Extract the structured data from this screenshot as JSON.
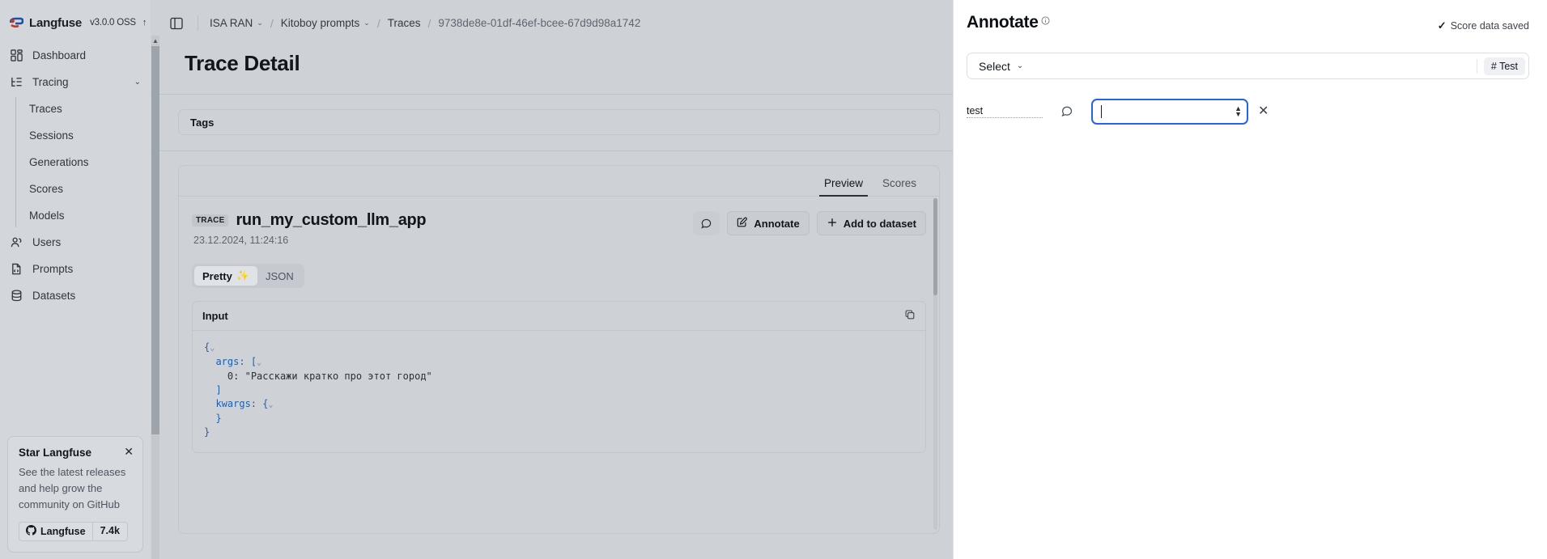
{
  "sidebar": {
    "brand": {
      "name": "Langfuse",
      "version": "v3.0.0 OSS",
      "arrow": "↑"
    },
    "items": [
      {
        "label": "Dashboard",
        "icon": "dashboard-icon"
      },
      {
        "label": "Tracing",
        "icon": "tracing-icon",
        "chevron": "⌄"
      },
      {
        "label": "Users",
        "icon": "users-icon"
      },
      {
        "label": "Prompts",
        "icon": "prompts-icon"
      },
      {
        "label": "Datasets",
        "icon": "datasets-icon"
      }
    ],
    "subitems": [
      {
        "label": "Traces"
      },
      {
        "label": "Sessions"
      },
      {
        "label": "Generations"
      },
      {
        "label": "Scores"
      },
      {
        "label": "Models"
      }
    ],
    "star_card": {
      "title": "Star Langfuse",
      "description": "See the latest releases and help grow the community on GitHub",
      "github_label": "Langfuse",
      "star_count": "7.4k",
      "close": "✕"
    }
  },
  "topbar": {
    "toggle_icon": "sidebar-toggle-icon",
    "breadcrumbs": [
      {
        "label": "ISA RAN",
        "chevron": "⌄"
      },
      {
        "label": "Kitoboy prompts",
        "chevron": "⌄"
      },
      {
        "label": "Traces",
        "chevron": ""
      },
      {
        "label": "9738de8e-01df-46ef-bcee-67d9d98a1742",
        "chevron": ""
      }
    ],
    "separator": "/"
  },
  "main": {
    "page_title": "Trace Detail",
    "tags_label": "Tags",
    "tabs": [
      {
        "label": "Preview",
        "active": true
      },
      {
        "label": "Scores",
        "active": false
      }
    ],
    "trace": {
      "badge": "TRACE",
      "name": "run_my_custom_llm_app",
      "timestamp": "23.12.2024, 11:24:16",
      "comment_icon": "comment-icon",
      "annotate_label": "Annotate",
      "annotate_icon": "edit-square-icon",
      "add_dataset_label": "Add to dataset",
      "add_dataset_icon": "plus-icon"
    },
    "view_toggle": [
      {
        "label": "Pretty",
        "emoji": "✨",
        "active": true
      },
      {
        "label": "JSON",
        "emoji": "",
        "active": false
      }
    ],
    "io": {
      "title": "Input",
      "copy_icon": "copy-icon",
      "lines": [
        {
          "indent": 0,
          "key": "",
          "open": "{",
          "caret": "⌄",
          "value": ""
        },
        {
          "indent": 1,
          "key": "args:",
          "open": "[",
          "caret": "⌄",
          "value": ""
        },
        {
          "indent": 2,
          "key": "0:",
          "open": "",
          "caret": "",
          "value": "\"Расскажи кратко про этот город\""
        },
        {
          "indent": 1,
          "key": "",
          "open": "]",
          "caret": "",
          "value": ""
        },
        {
          "indent": 1,
          "key": "kwargs:",
          "open": "{",
          "caret": "⌄",
          "value": ""
        },
        {
          "indent": 1,
          "key": "",
          "open": "}",
          "caret": "",
          "value": ""
        },
        {
          "indent": 0,
          "key": "",
          "open": "}",
          "caret": "",
          "value": ""
        }
      ]
    }
  },
  "panel": {
    "title": "Annotate",
    "info_icon": "info-icon",
    "saved_text": "Score data saved",
    "saved_check": "✓",
    "select": {
      "label": "Select",
      "chevron": "⌄",
      "chip": "# Test"
    },
    "score_row": {
      "name": "test",
      "comment_icon": "comment-icon",
      "value": "",
      "spinner_up": "▲",
      "spinner_down": "▼",
      "clear": "✕"
    }
  },
  "colors": {
    "accent_blue": "#2563eb",
    "page_bg": "#ced2d6",
    "sidebar_bg": "#d3d6da",
    "panel_bg": "#ffffff",
    "json_blue": "#1f5fae"
  }
}
